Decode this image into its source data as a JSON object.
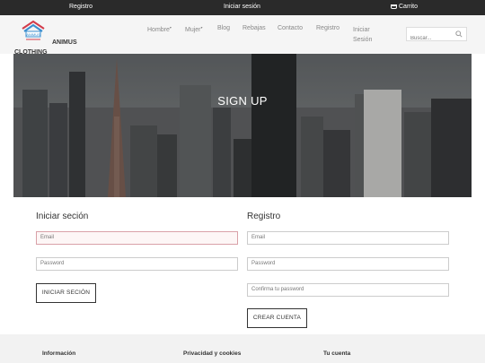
{
  "topbar": {
    "registro": "Registro",
    "login": "Iniciar sesión",
    "cart": "Carrito"
  },
  "brand": {
    "logo_text": "ANIMUS",
    "logo_sub": "CLOTHING",
    "logo_mark": "ANIMUS"
  },
  "nav": {
    "hombre": "Hombre",
    "mujer": "Mujer",
    "blog": "Blog",
    "rebajas": "Rebajas",
    "contacto": "Contacto",
    "registro": "Registro",
    "iniciar_1": "Iniciar",
    "iniciar_2": "Sesión"
  },
  "search": {
    "placeholder": "Buscar..."
  },
  "hero": {
    "title": "SIGN UP"
  },
  "login": {
    "title": "Iniciar seción",
    "email_placeholder": "Email",
    "password_placeholder": "Password",
    "button": "INICIAR SECIÓN"
  },
  "register": {
    "title": "Registro",
    "email_placeholder": "Email",
    "password_placeholder": "Password",
    "confirm_placeholder": "Confirma tu password",
    "button": "CREAR CUENTA"
  },
  "footer": {
    "info": "Información",
    "privacy": "Privacidad y cookies",
    "account": "Tu cuenta"
  },
  "colors": {
    "topbar": "#2a2a2a",
    "header": "#f5f5f5",
    "error_border": "#d9a1a8",
    "footer": "#f2f2f2"
  }
}
